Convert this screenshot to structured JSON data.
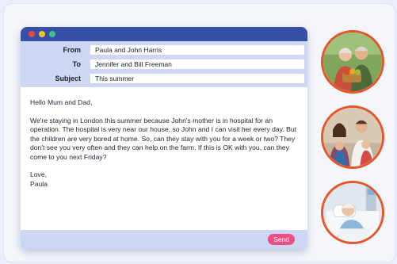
{
  "email": {
    "window_buttons": [
      "close",
      "minimize",
      "maximize"
    ],
    "fields": [
      {
        "label": "From",
        "value": "Paula and John Harris"
      },
      {
        "label": "To",
        "value": "Jennifer and Bill Freeman"
      },
      {
        "label": "Subject",
        "value": "This summer"
      }
    ],
    "greeting": "Hello Mum and Dad,",
    "message": "We're staying in London this summer because John's mother is in hospital for an operation. The hospital is very near our house, so John and I can visit her every day. But the children are very bored at home. So, can they stay with you for a week or two? They don't see you very often and they can help on the farm. If this is OK with you, can they come to you next Friday?",
    "closing": "Love,",
    "signature": "Paula",
    "send_label": "Send"
  },
  "photos": [
    {
      "icon": "older-couple-photo"
    },
    {
      "icon": "family-photo"
    },
    {
      "icon": "hospital-patient-photo"
    }
  ],
  "colors": {
    "titlebar": "#3650a8",
    "header_bg": "#cdd6f2",
    "send_button": "#ec4f86",
    "photo_border": "#e5572b"
  }
}
